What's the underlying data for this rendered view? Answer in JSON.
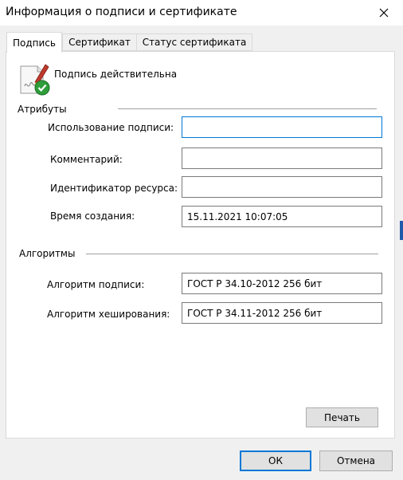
{
  "window": {
    "title": "Информация о подписи и сертификате"
  },
  "tabs": [
    {
      "label": "Подпись"
    },
    {
      "label": "Сертификат"
    },
    {
      "label": "Статус сертификата"
    }
  ],
  "status": {
    "text": "Подпись действительна"
  },
  "attributes": {
    "group_label": "Атрибуты",
    "fields": [
      {
        "label": "Использование подписи:",
        "value": ""
      },
      {
        "label": "Комментарий:",
        "value": ""
      },
      {
        "label": "Идентификатор ресурса:",
        "value": ""
      },
      {
        "label": "Время создания:",
        "value": "15.11.2021 10:07:05"
      }
    ]
  },
  "algorithms": {
    "group_label": "Алгоритмы",
    "fields": [
      {
        "label": "Алгоритм подписи:",
        "value": "ГОСТ Р 34.10-2012 256 бит"
      },
      {
        "label": "Алгоритм хеширования:",
        "value": "ГОСТ Р 34.11-2012 256 бит"
      }
    ]
  },
  "buttons": {
    "print": "Печать",
    "ok": "ОК",
    "cancel": "Отмена"
  },
  "colors": {
    "focus": "#0078d7",
    "check": "#2e9e3a",
    "pen": "#c0392b"
  }
}
